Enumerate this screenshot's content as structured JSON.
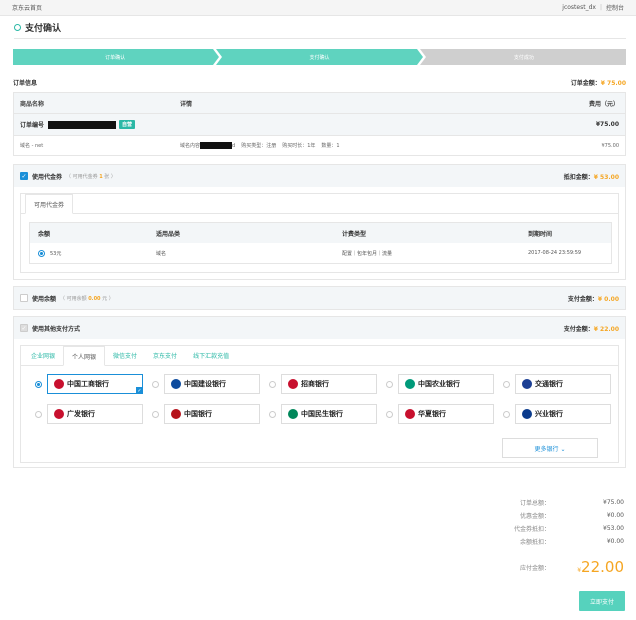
{
  "topbar": {
    "home_link": "京东云首页",
    "user": "jcostest_dx",
    "separator": "|",
    "console": "控制台"
  },
  "page_title": "支付确认",
  "steps": [
    {
      "label": "订单确认",
      "state": "done"
    },
    {
      "label": "支付确认",
      "state": "current"
    },
    {
      "label": "支付成功",
      "state": "pending"
    }
  ],
  "order": {
    "title": "订单信息",
    "total_label": "订单金额：",
    "total_value": "¥ 75.00",
    "columns": [
      "商品名称",
      "详情",
      "费用（元）"
    ],
    "order_no_label": "订单编号",
    "order_badge": "自营",
    "order_subtotal": "¥75.00",
    "item_name": "域名 - net",
    "item_detail_prefix": "域名内容",
    "item_detail_suffix": "d",
    "item_buy_type": "购买类型：注册",
    "item_duration": "购买时长：1年",
    "item_qty": "数量：1",
    "item_price": "¥75.00"
  },
  "coupon": {
    "label": "使用代金券",
    "hint_prefix": "（ 可用代金券",
    "hint_count": "1",
    "hint_suffix": "张 ）",
    "deduct_label": "抵扣金额：",
    "deduct_value": "¥ 53.00",
    "tab": "可用代金券",
    "columns": [
      "余额",
      "适用品类",
      "计费类型",
      "到期时间"
    ],
    "row": {
      "balance": "53元",
      "category": "域名",
      "billing": "配置｜包年包月｜流量",
      "expires": "2017-08-24 23:59:59"
    }
  },
  "balance": {
    "label": "使用余额",
    "hint_prefix": "（ 可用余额",
    "hint_value": "0.00",
    "hint_suffix": "元 ）",
    "pay_label": "支付金额：",
    "pay_value": "¥ 0.00"
  },
  "other_pay": {
    "label": "使用其他支付方式",
    "pay_label": "支付金额：",
    "pay_value": "¥ 22.00",
    "tabs": [
      "企业网银",
      "个人网银",
      "微信支付",
      "京东支付",
      "线下汇款充值"
    ],
    "banks": [
      {
        "name": "中国工商银行",
        "color": "#c8102e"
      },
      {
        "name": "中国建设银行",
        "color": "#0d4b9e"
      },
      {
        "name": "招商银行",
        "color": "#c8102e"
      },
      {
        "name": "中国农业银行",
        "color": "#009a7a"
      },
      {
        "name": "交通银行",
        "color": "#1c3f94"
      },
      {
        "name": "广发银行",
        "color": "#c8102e"
      },
      {
        "name": "中国银行",
        "color": "#b5121b"
      },
      {
        "name": "中国民生银行",
        "color": "#00875a"
      },
      {
        "name": "华夏银行",
        "color": "#c8102e"
      },
      {
        "name": "兴业银行",
        "color": "#0b3b8c"
      }
    ],
    "more": "更多银行 ⌄"
  },
  "summary": {
    "rows": [
      {
        "label": "订单总额：",
        "value": "¥75.00"
      },
      {
        "label": "优惠金额：",
        "value": "¥0.00"
      },
      {
        "label": "代金券抵扣：",
        "value": "¥53.00"
      },
      {
        "label": "余额抵扣：",
        "value": "¥0.00"
      }
    ],
    "pay_label": "应付金额：",
    "currency": "¥",
    "pay_amount": "22.00",
    "pay_button": "立即支付"
  },
  "colors": {
    "accent": "#2bb8a6",
    "orange": "#f5a623",
    "link": "#1a8fd8",
    "step_done": "#5fd3bf",
    "step_pending": "#cfcfcf"
  }
}
